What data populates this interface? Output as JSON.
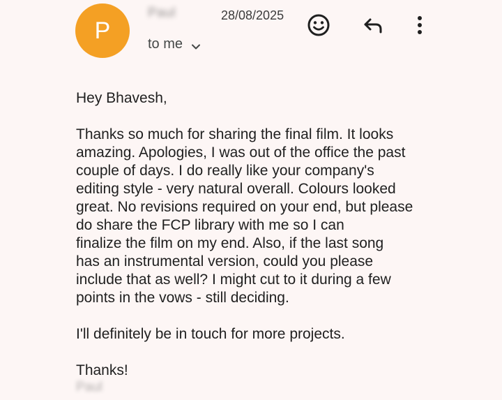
{
  "header": {
    "avatar_letter": "P",
    "avatar_color": "#f4a024",
    "sender_name": "Paul",
    "date": "28/08/2025",
    "recipient_label": "to me",
    "icons": {
      "emoji": "smiley-icon",
      "reply": "reply-icon",
      "more": "more-vert-icon",
      "chevron": "chevron-down-icon"
    }
  },
  "message": {
    "greeting": "Hey Bhavesh,",
    "paragraph_lines": [
      "Thanks so much for sharing the final film. It looks",
      "amazing. Apologies, I was out of the office the past",
      "couple of days. I do really like your company's",
      "editing style - very natural overall. Colours looked",
      "great. No revisions required on your end, but please",
      "do share the FCP library with me so I can",
      "finalize the film on my end. Also, if the last song",
      "has an instrumental version, could you please",
      "include that as well? I might cut to it during a few",
      "points in the vows - still deciding."
    ],
    "followup": "I'll definitely be in touch for more projects.",
    "signoff": "Thanks!",
    "signature": "Paul"
  }
}
